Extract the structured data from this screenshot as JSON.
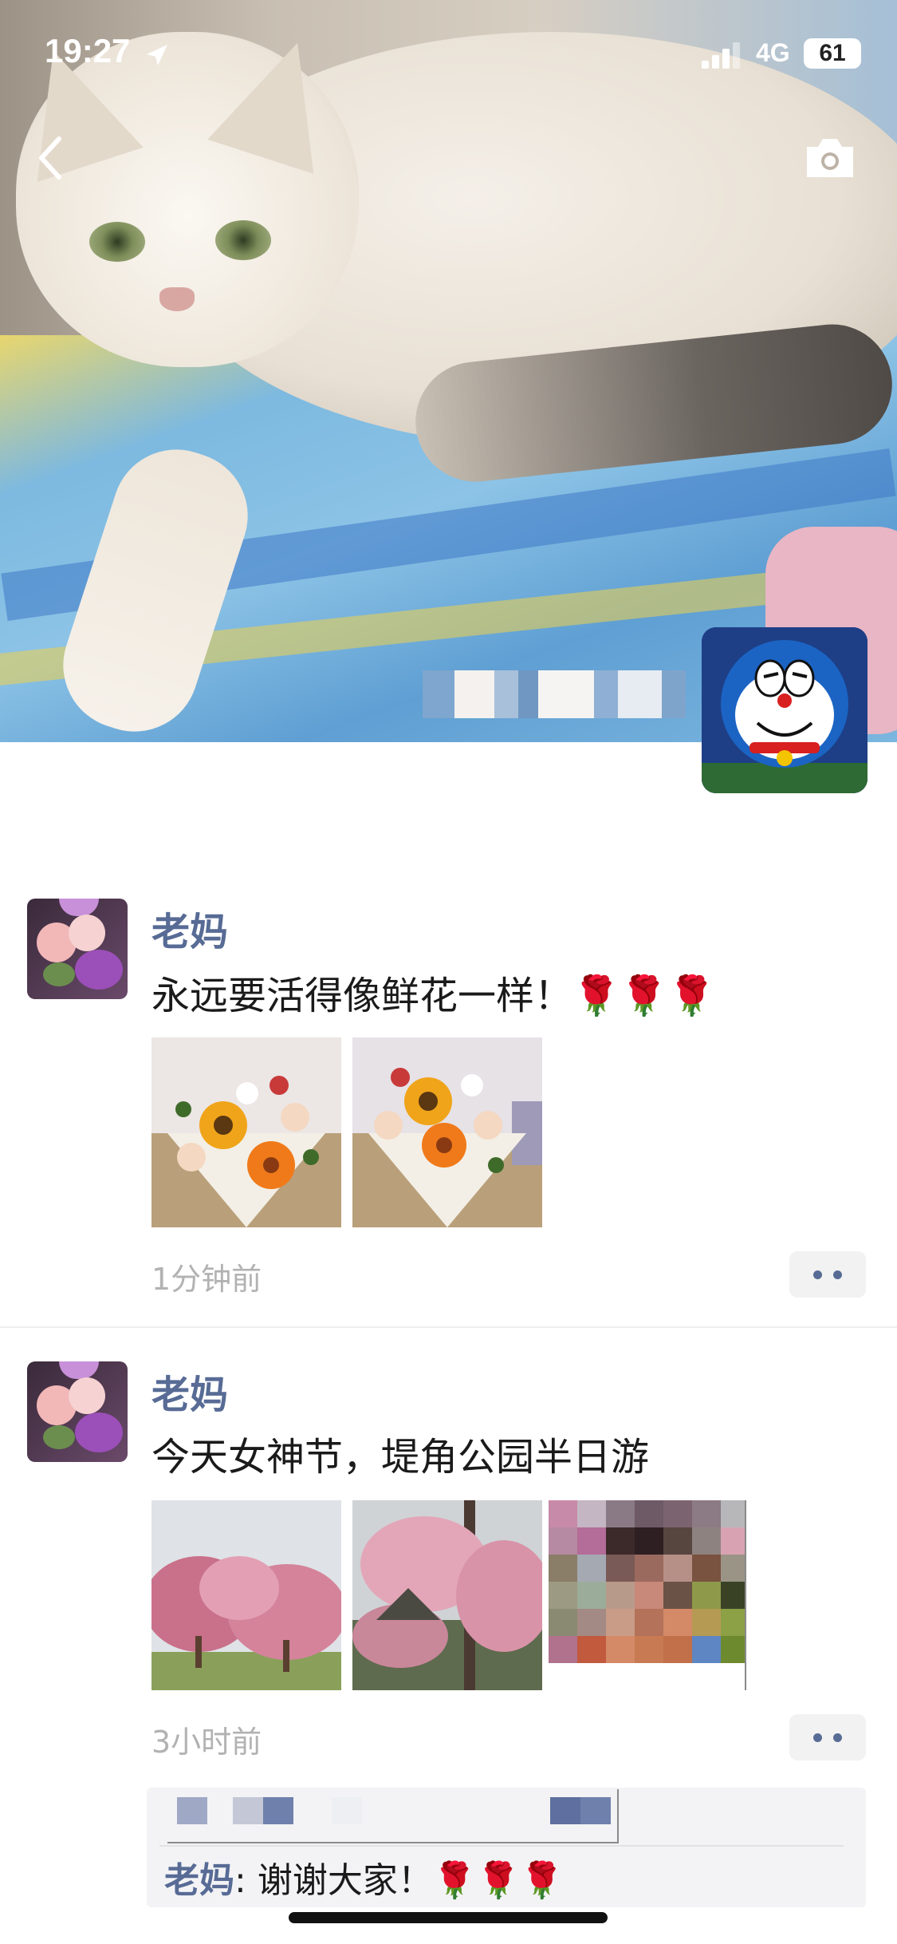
{
  "status_bar": {
    "time": "19:27",
    "network": "4G",
    "battery": "61"
  },
  "colors": {
    "link": "#576b95",
    "text": "#1a1a1a",
    "muted": "#b2b2b2"
  },
  "posts": [
    {
      "author": "老妈",
      "text": "永远要活得像鲜花一样！🌹🌹🌹",
      "images": [
        "flower-bouquet-photo",
        "flower-bouquet-photo"
      ],
      "time": "1分钟前"
    },
    {
      "author": "老妈",
      "text": "今天女神节，堤角公园半日游",
      "images": [
        "cherry-blossom-trees-photo",
        "cherry-blossom-branch-photo",
        "pixelated-photo"
      ],
      "time": "3小时前",
      "comment": {
        "author": "老妈",
        "separator": ":",
        "text": " 谢谢大家！🌹🌹🌹"
      }
    }
  ]
}
